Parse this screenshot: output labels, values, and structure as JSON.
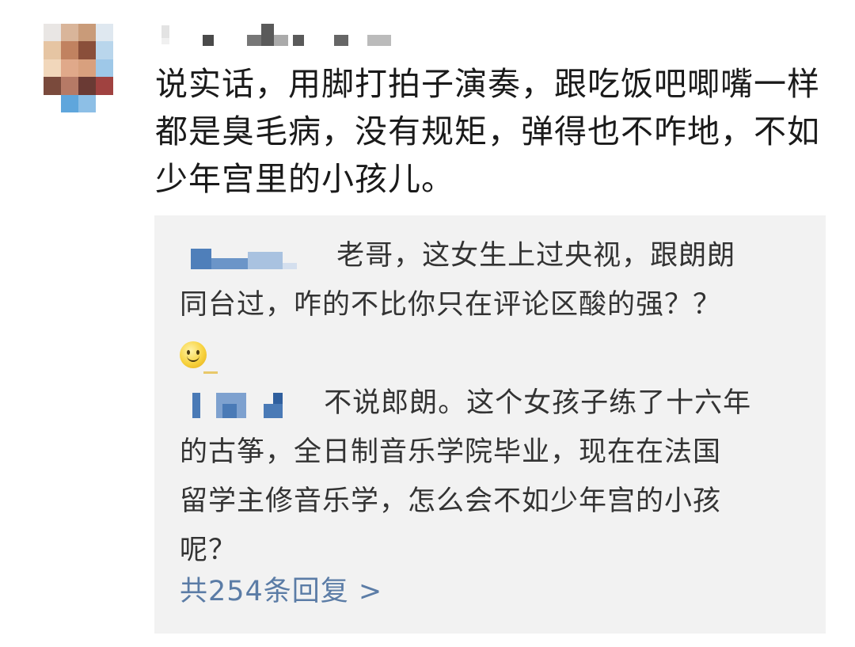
{
  "comment": {
    "lines": [
      "说实话，用脚打拍子演奏，跟吃饭吧唧嘴一样",
      "都是臭毛病，没有规矩，弹得也不咋地，不如",
      "少年宫里的小孩儿。"
    ]
  },
  "replies": [
    {
      "first_line": "老哥，这女生上过央视，跟朗朗",
      "lines": [
        "同台过，咋的不比你只在评论区酸的强？？"
      ],
      "emoji": "smile-emoji"
    },
    {
      "first_line": "不说郎朗。这个女孩子练了十六年",
      "lines": [
        "的古筝，全日制音乐学院毕业，现在在法国",
        "留学主修音乐学，怎么会不如少年宫的小孩",
        "呢？"
      ]
    }
  ],
  "more_replies": "共254条回复 >",
  "colors": {
    "text": "#1a1a1a",
    "reply_text": "#333333",
    "reply_bg": "#f2f2f2",
    "link": "#5b7ca6"
  }
}
